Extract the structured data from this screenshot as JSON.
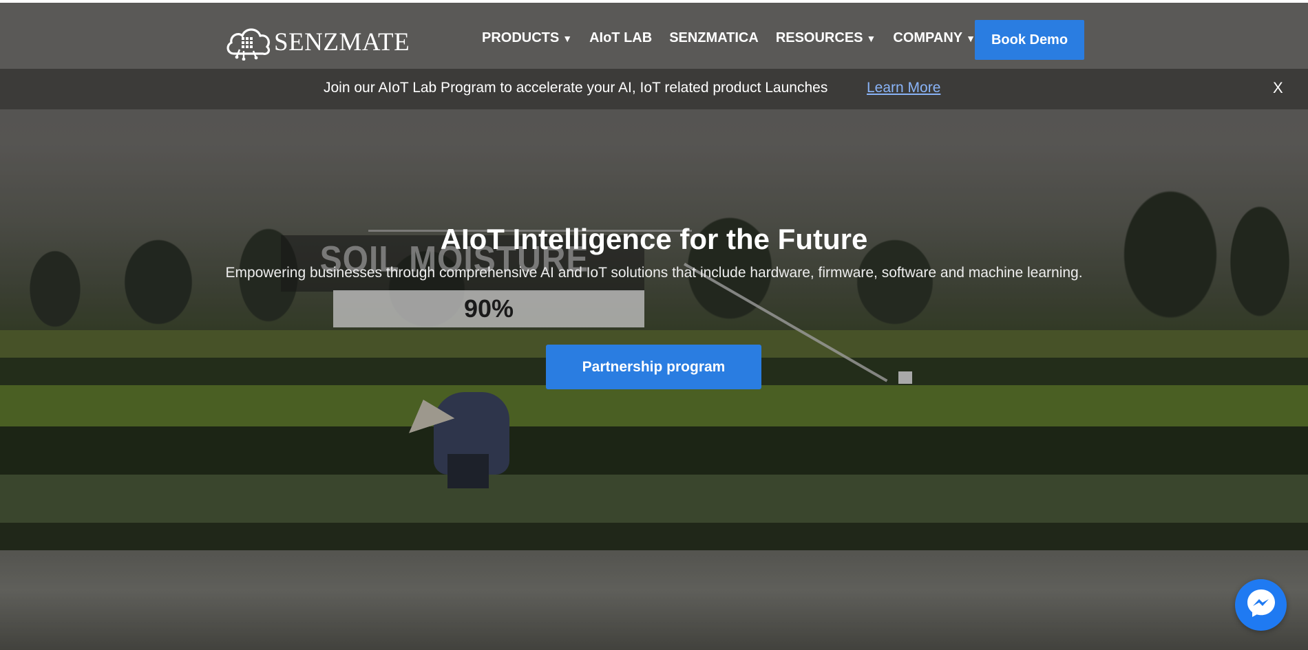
{
  "header": {
    "logo_text": "SENZMATE",
    "nav": [
      {
        "label": "PRODUCTS",
        "dropdown": true
      },
      {
        "label": "AIoT LAB",
        "dropdown": false
      },
      {
        "label": "SENZMATICA",
        "dropdown": false
      },
      {
        "label": "RESOURCES",
        "dropdown": true
      },
      {
        "label": "COMPANY",
        "dropdown": true
      }
    ],
    "caret": "▼",
    "book_demo": "Book Demo"
  },
  "announcement": {
    "text": "Join our AIoT Lab Program to accelerate your AI, IoT related product Launches",
    "link": "Learn More",
    "close": "X"
  },
  "hero": {
    "title": "AIoT Intelligence for the Future",
    "subtitle": "Empowering businesses through comprehensive AI and IoT solutions that include hardware, firmware, software and machine learning.",
    "cta": "Partnership program",
    "overlay_title": "SOIL MOISTURE",
    "overlay_value": "90%"
  },
  "colors": {
    "accent": "#2a7de1",
    "link": "#8ab4f8",
    "messenger": "#1f7af2"
  },
  "icons": {
    "logo": "cloud-chip-icon",
    "chat": "messenger-icon"
  }
}
